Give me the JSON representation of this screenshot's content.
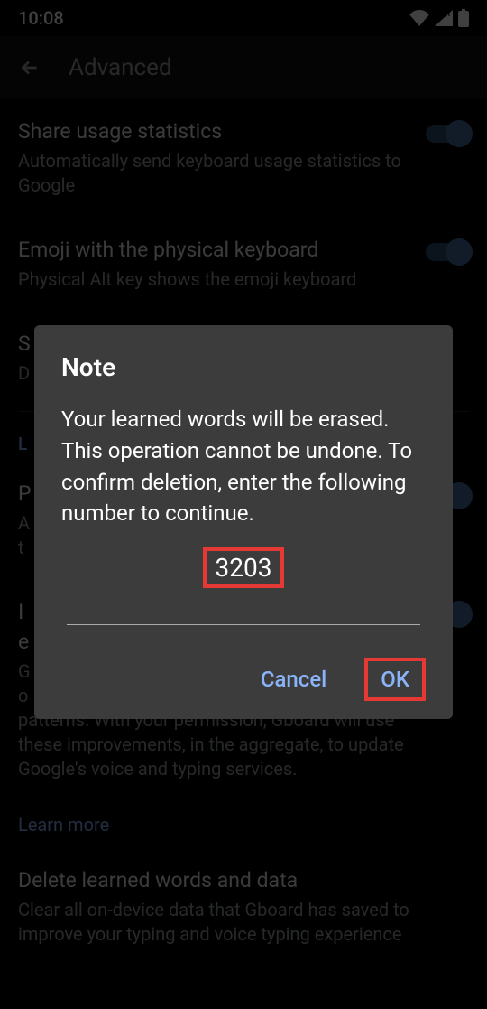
{
  "status": {
    "time": "10:08"
  },
  "header": {
    "title": "Advanced"
  },
  "settings": {
    "share": {
      "title": "Share usage statistics",
      "desc": "Automatically send keyboard usage statistics to Google"
    },
    "emoji": {
      "title": "Emoji with the physical keyboard",
      "desc": "Physical Alt key shows the emoji keyboard"
    },
    "s_partial": {
      "title": "S",
      "desc": "D"
    },
    "section_l": "L",
    "p_partial": {
      "title": "P",
      "desc_a": "A",
      "desc_t": "t"
    },
    "i_partial": {
      "title_i": "I",
      "title_e": "e",
      "desc": "G\no\npatterns. With your permission, Gboard will use these improvements, in the aggregate, to update Google's voice and typing services."
    },
    "learn_more": "Learn more",
    "delete": {
      "title": "Delete learned words and data",
      "desc": "Clear all on-device data that Gboard has saved to improve your typing and voice typing experience"
    }
  },
  "dialog": {
    "title": "Note",
    "body": "Your learned words will be erased. This operation cannot be undone. To confirm deletion, enter the following number to continue.",
    "code": "3203",
    "cancel": "Cancel",
    "ok": "OK"
  }
}
